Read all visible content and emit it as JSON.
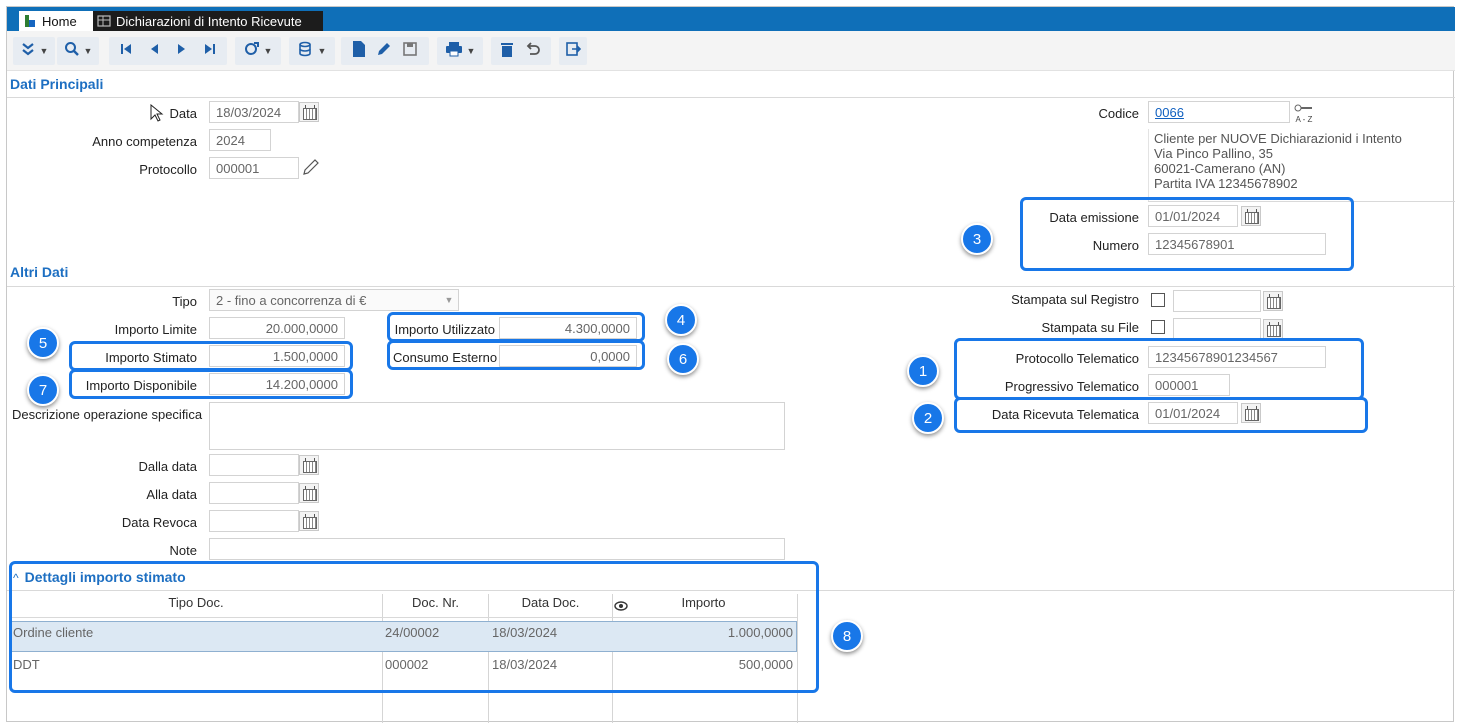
{
  "tabs": {
    "home": "Home",
    "current": "Dichiarazioni di Intento Ricevute"
  },
  "toolbar_icons": [
    "expand-icon",
    "search-icon",
    "first-record-icon",
    "previous-record-icon",
    "next-record-icon",
    "last-record-icon",
    "view-options-icon",
    "database-icon",
    "new-document-icon",
    "edit-icon",
    "save-icon",
    "print-icon",
    "delete-icon",
    "undo-icon",
    "exit-icon"
  ],
  "sections": {
    "main": "Dati Principali",
    "other": "Altri Dati",
    "details": "Dettagli importo stimato"
  },
  "main": {
    "data_label": "Data",
    "data_value": "18/03/2024",
    "anno_label": "Anno competenza",
    "anno_value": "2024",
    "protocollo_label": "Protocollo",
    "protocollo_value": "000001",
    "codice_label": "Codice",
    "codice_value": "0066",
    "codice_icon_text": "A - Z",
    "customer_line1": "Cliente per NUOVE Dichiarazionid i Intento",
    "customer_line2": "Via Pinco Pallino, 35",
    "customer_line3": "60021-Camerano (AN)",
    "customer_line4": "Partita IVA 12345678902",
    "emissione_label": "Data emissione",
    "emissione_value": "01/01/2024",
    "numero_label": "Numero",
    "numero_value": "12345678901"
  },
  "other": {
    "tipo_label": "Tipo",
    "tipo_value": "2 - fino a concorrenza di €",
    "limite_label": "Importo Limite",
    "limite_value": "20.000,0000",
    "stimato_label": "Importo Stimato",
    "stimato_value": "1.500,0000",
    "disponibile_label": "Importo Disponibile",
    "disponibile_value": "14.200,0000",
    "utilizzato_label": "Importo Utilizzato",
    "utilizzato_value": "4.300,0000",
    "consumo_label": "Consumo Esterno",
    "consumo_value": "0,0000",
    "descrizione_label": "Descrizione operazione specifica",
    "dalla_label": "Dalla data",
    "alla_label": "Alla data",
    "revoca_label": "Data Revoca",
    "note_label": "Note",
    "registro_label": "Stampata sul Registro",
    "file_label": "Stampata su File",
    "prot_tel_label": "Protocollo Telematico",
    "prot_tel_value": "12345678901234567",
    "prog_tel_label": "Progressivo Telematico",
    "prog_tel_value": "000001",
    "ricevuta_label": "Data Ricevuta Telematica",
    "ricevuta_value": "01/01/2024"
  },
  "grid": {
    "columns": [
      "Tipo Doc.",
      "Doc. Nr.",
      "Data Doc.",
      "Importo"
    ],
    "rows": [
      {
        "tipo": "Ordine cliente",
        "nr": "24/00002",
        "data": "18/03/2024",
        "importo": "1.000,0000"
      },
      {
        "tipo": "DDT",
        "nr": "000002",
        "data": "18/03/2024",
        "importo": "500,0000"
      }
    ]
  },
  "badges": [
    "1",
    "2",
    "3",
    "4",
    "5",
    "6",
    "7",
    "8"
  ],
  "colors": {
    "accent": "#1877e8",
    "tabbar": "#0f6fb8",
    "section_title": "#1d6fc2"
  }
}
